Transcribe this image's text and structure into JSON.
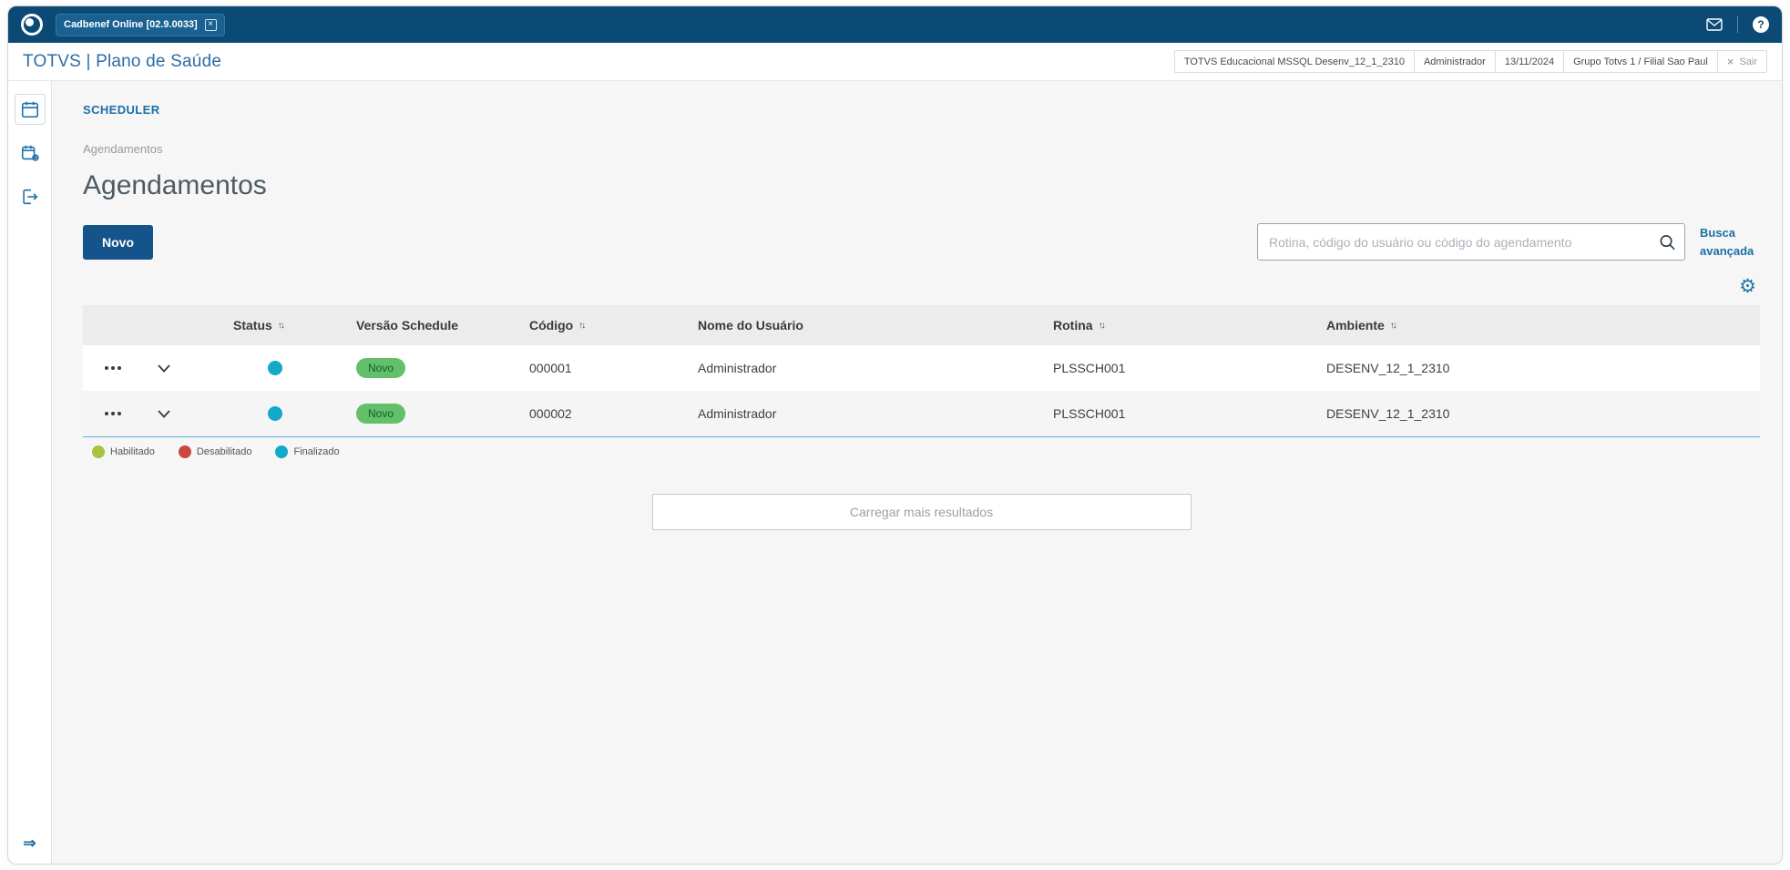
{
  "colors": {
    "topbar": "#0b4a74",
    "primary_button": "#15548b",
    "link": "#1b6fa8",
    "table_bottom_border": "#5fb0e5",
    "badge_bg": "#63bf6a",
    "badge_text": "#135c2d"
  },
  "icons": {
    "tab_close": "×",
    "help": "?",
    "exit_x": "×",
    "sort": "↑↓",
    "gear": "⚙",
    "sidebar_expand": "⇒"
  },
  "topbar": {
    "tab_label": "Cadbenef Online [02.9.0033]"
  },
  "header": {
    "brand": "TOTVS | Plano de Saúde",
    "info": [
      "TOTVS Educacional MSSQL Desenv_12_1_2310",
      "Administrador",
      "13/11/2024",
      "Grupo Totvs 1 / Filial Sao Paul"
    ],
    "exit_label": "Sair"
  },
  "page": {
    "section_title": "SCHEDULER",
    "breadcrumb": "Agendamentos",
    "title": "Agendamentos",
    "new_button": "Novo",
    "search_placeholder": "Rotina, código do usuário ou código do agendamento",
    "advanced_search": "Busca avançada",
    "load_more": "Carregar mais resultados"
  },
  "table": {
    "columns": [
      {
        "label": "Status",
        "sortable": true
      },
      {
        "label": "Versão Schedule",
        "sortable": false
      },
      {
        "label": "Código",
        "sortable": true
      },
      {
        "label": "Nome do Usuário",
        "sortable": false
      },
      {
        "label": "Rotina",
        "sortable": true
      },
      {
        "label": "Ambiente",
        "sortable": true
      }
    ],
    "rows": [
      {
        "status": "Finalizado",
        "status_color": "#13a9c9",
        "versao_badge": "Novo",
        "codigo": "000001",
        "usuario": "Administrador",
        "rotina": "PLSSCH001",
        "ambiente": "DESENV_12_1_2310"
      },
      {
        "status": "Finalizado",
        "status_color": "#13a9c9",
        "versao_badge": "Novo",
        "codigo": "000002",
        "usuario": "Administrador",
        "rotina": "PLSSCH001",
        "ambiente": "DESENV_12_1_2310"
      }
    ],
    "legend": [
      {
        "label": "Habilitado",
        "color": "#a8c43f"
      },
      {
        "label": "Desabilitado",
        "color": "#c7493f"
      },
      {
        "label": "Finalizado",
        "color": "#13a9c9"
      }
    ]
  }
}
